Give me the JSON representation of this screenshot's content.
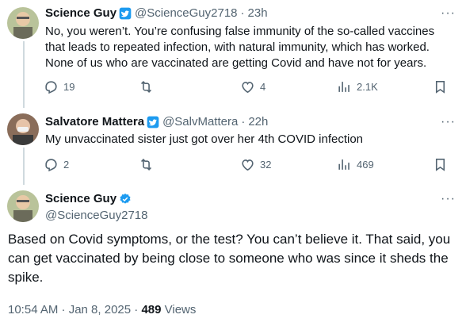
{
  "tweets": [
    {
      "name": "Science Guy",
      "handle": "@ScienceGuy2718",
      "time": "23h",
      "text": "No, you weren’t. You’re confusing false immunity of the so-called vaccines that leads to repeated infection, with natural immunity, which has worked. None of us who are vaccinated are getting Covid and have not for years.",
      "replies": "19",
      "retweets": "",
      "likes": "4",
      "views": "2.1K"
    },
    {
      "name": "Salvatore Mattera",
      "handle": "@SalvMattera",
      "time": "22h",
      "text": "My unvaccinated sister just got over her 4th COVID infection",
      "replies": "2",
      "retweets": "",
      "likes": "32",
      "views": "469"
    }
  ],
  "focus": {
    "name": "Science Guy",
    "handle": "@ScienceGuy2718",
    "text": "Based on Covid symptoms, or the test? You can’t believe it. That said, you can get vaccinated by being close to someone who was since it sheds the spike.",
    "time": "10:54 AM · Jan 8, 2025 · ",
    "views_count": "489",
    "views_label": " Views"
  },
  "separator": "·",
  "more": "···",
  "colors": {
    "blue_badge": "#1d9bf0",
    "text": "#0f1419",
    "muted": "#536471",
    "thread_line": "#cfd9de"
  },
  "icons": [
    "verified-badge-icon",
    "reply-icon",
    "retweet-icon",
    "like-icon",
    "views-icon",
    "bookmark-icon",
    "more-icon"
  ]
}
